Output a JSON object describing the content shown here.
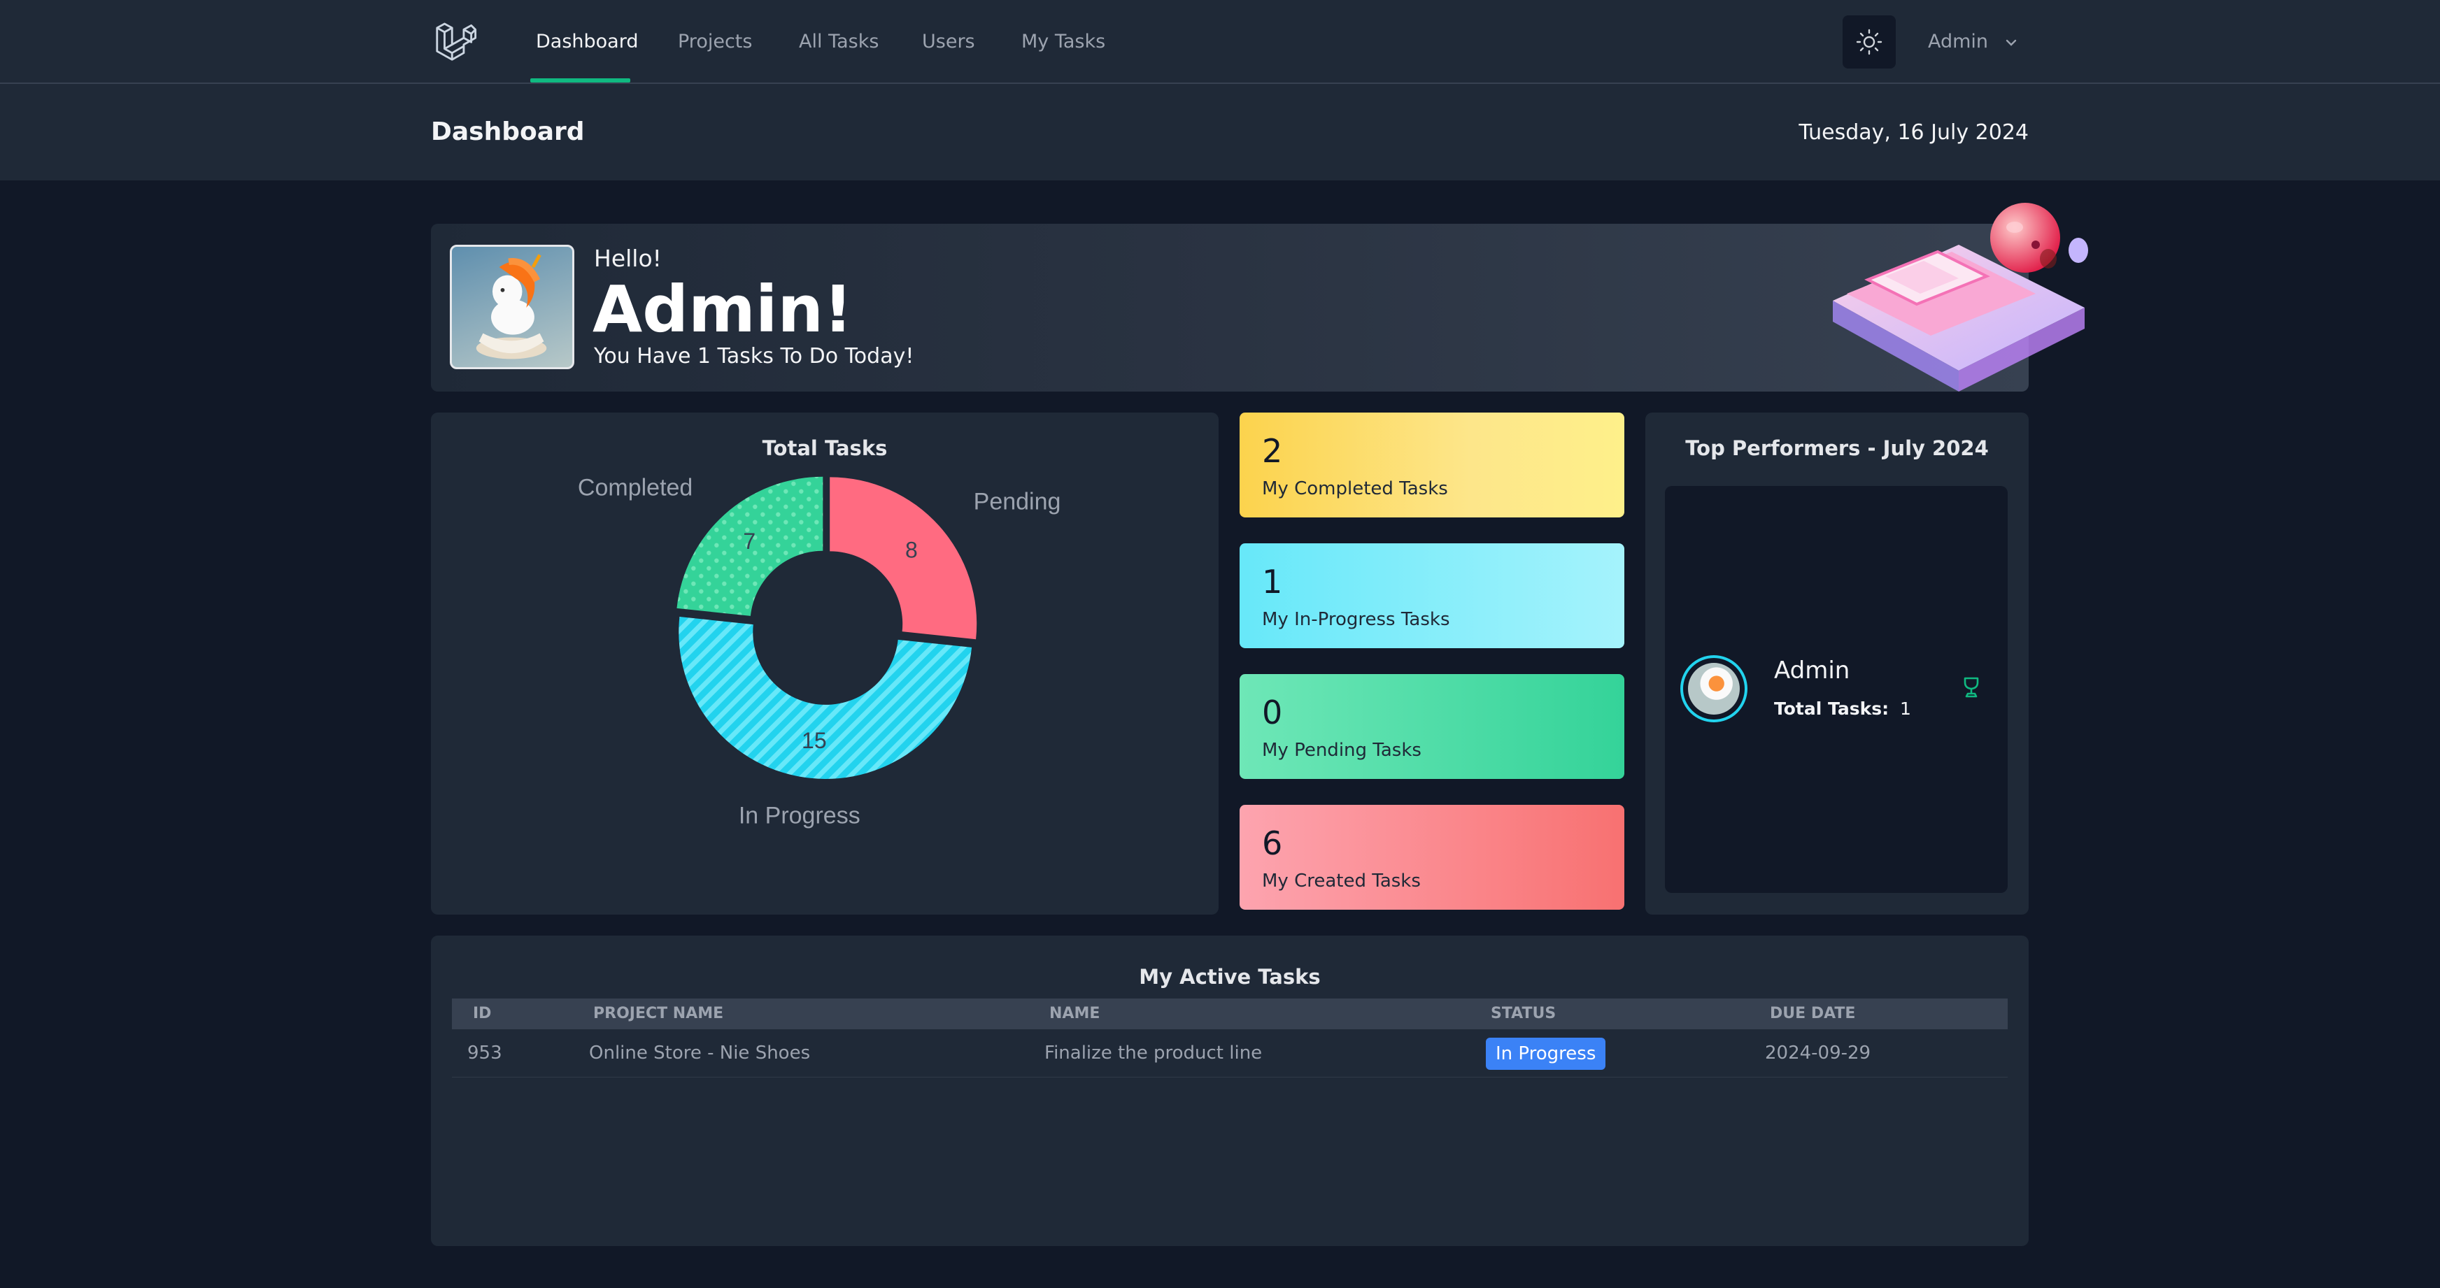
{
  "nav": {
    "links": [
      "Dashboard",
      "Projects",
      "All Tasks",
      "Users",
      "My Tasks"
    ],
    "user": "Admin"
  },
  "header": {
    "title": "Dashboard",
    "date": "Tuesday, 16 July 2024"
  },
  "welcome": {
    "hello": "Hello!",
    "name": "Admin!",
    "message": "You Have 1 Tasks To Do Today!"
  },
  "total_tasks": {
    "title": "Total Tasks",
    "chart_data": {
      "type": "pie",
      "categories": [
        "Pending",
        "In Progress",
        "Completed"
      ],
      "values": [
        8,
        15,
        7
      ],
      "colors": [
        "#ff6b81",
        "#22d3ee",
        "#34d399"
      ]
    }
  },
  "stats": [
    {
      "value": "2",
      "label": "My Completed Tasks"
    },
    {
      "value": "1",
      "label": "My In-Progress Tasks"
    },
    {
      "value": "0",
      "label": "My Pending Tasks"
    },
    {
      "value": "6",
      "label": "My Created Tasks"
    }
  ],
  "top_performers": {
    "title": "Top Performers - July 2024",
    "name": "Admin",
    "total_label": "Total Tasks:",
    "total_value": "1"
  },
  "active_tasks": {
    "title": "My Active Tasks",
    "columns": [
      "ID",
      "PROJECT NAME",
      "NAME",
      "STATUS",
      "DUE DATE"
    ],
    "rows": [
      {
        "id": "953",
        "project": "Online Store - Nie Shoes",
        "name": "Finalize the product line",
        "status": "In Progress",
        "due": "2024-09-29"
      }
    ]
  }
}
